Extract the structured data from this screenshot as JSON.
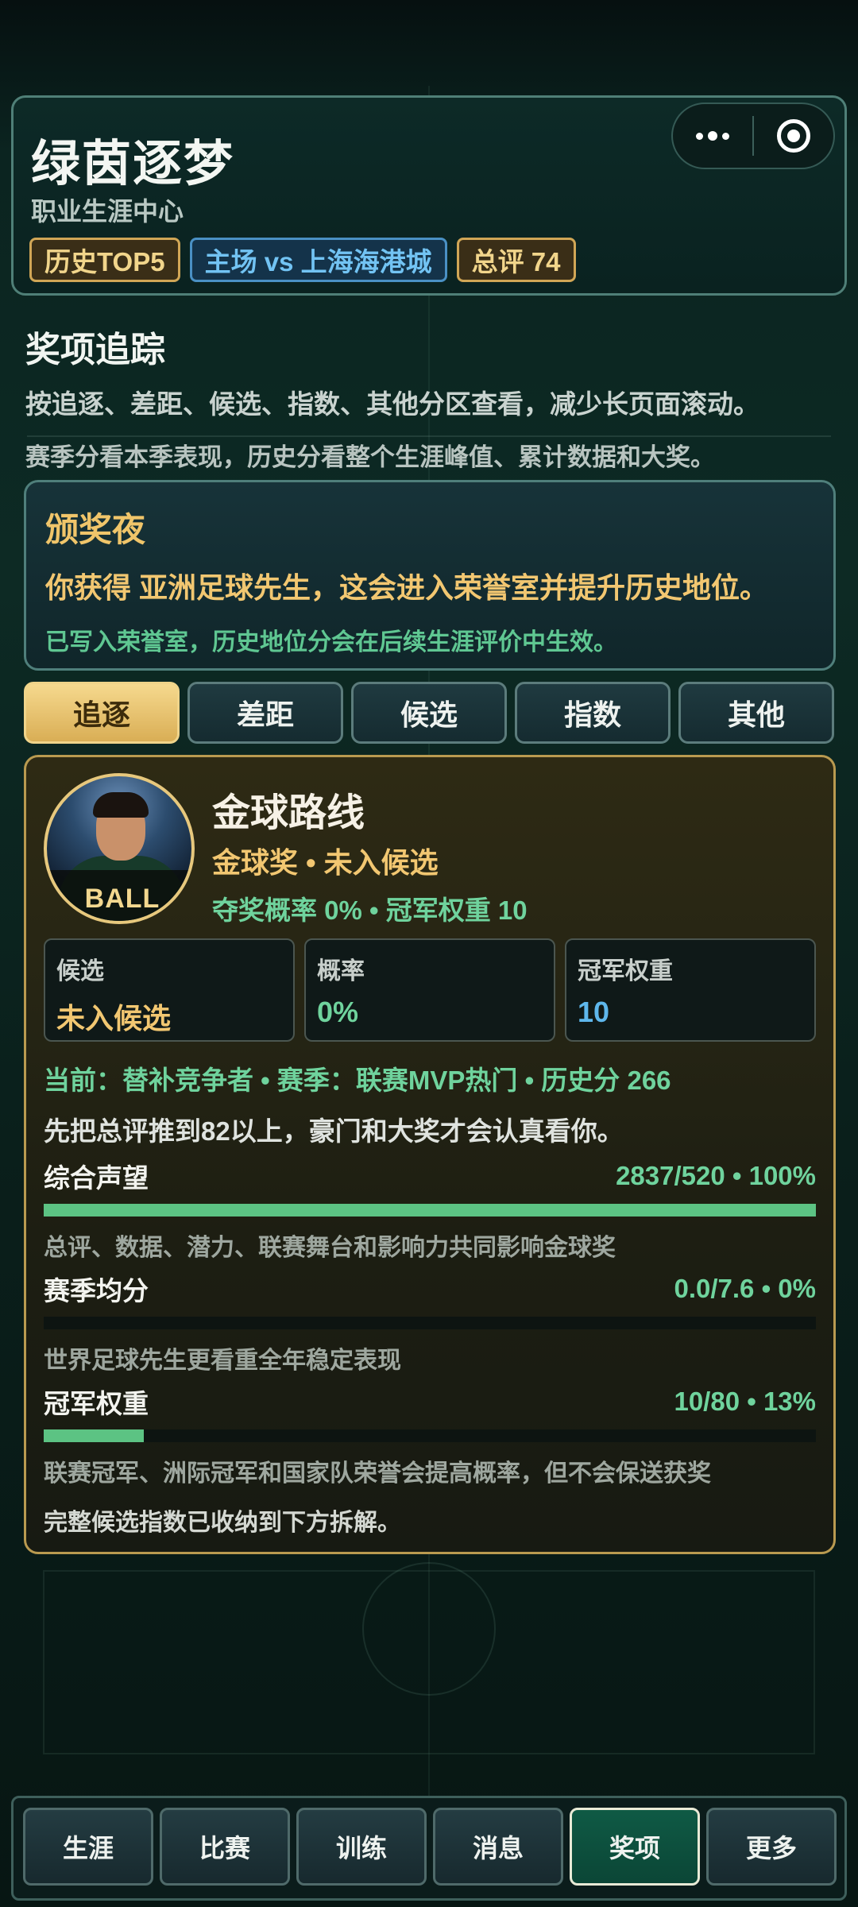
{
  "header": {
    "title": "绿茵逐梦",
    "subtitle": "职业生涯中心",
    "badges": [
      {
        "label": "历史TOP5",
        "style": "gold"
      },
      {
        "label": "主场 vs 上海海港城",
        "style": "blue"
      },
      {
        "label": "总评 74",
        "style": "gold"
      }
    ],
    "menu_icon": "more-dots-icon",
    "close_icon": "target-close-icon"
  },
  "section": {
    "title": "奖项追踪",
    "desc1": "按追逐、差距、候选、指数、其他分区查看，减少长页面滚动。",
    "desc2": "赛季分看本季表现，历史分看整个生涯峰值、累计数据和大奖。"
  },
  "award_night": {
    "title": "颁奖夜",
    "text": "你获得 亚洲足球先生，这会进入荣誉室并提升历史地位。",
    "note": "已写入荣誉室，历史地位分会在后续生涯评价中生效。"
  },
  "tabs": [
    {
      "label": "追逐",
      "active": true
    },
    {
      "label": "差距",
      "active": false
    },
    {
      "label": "候选",
      "active": false
    },
    {
      "label": "指数",
      "active": false
    },
    {
      "label": "其他",
      "active": false
    }
  ],
  "card": {
    "avatar_label": "BALL",
    "title": "金球路线",
    "subtitle": "金球奖 • 未入候选",
    "subtitle2": "夺奖概率 0% • 冠军权重 10",
    "stats": [
      {
        "label": "候选",
        "value": "未入候选",
        "color": "#f2c771"
      },
      {
        "label": "概率",
        "value": "0%",
        "color": "#6fd39d"
      },
      {
        "label": "冠军权重",
        "value": "10",
        "color": "#5eb7ec"
      }
    ],
    "info_line": "当前：替补竞争者 • 赛季：联赛MVP热门 • 历史分 266",
    "info_line2": "先把总评推到82以上，豪门和大奖才会认真看你。",
    "metrics": [
      {
        "name": "综合声望",
        "value": "2837/520 • 100%",
        "progress": 1.0,
        "note": "总评、数据、潜力、联赛舞台和影响力共同影响金球奖"
      },
      {
        "name": "赛季均分",
        "value": "0.0/7.6 • 0%",
        "progress": 0.0,
        "note": "世界足球先生更看重全年稳定表现"
      },
      {
        "name": "冠军权重",
        "value": "10/80 • 13%",
        "progress": 0.13,
        "note": "联赛冠军、洲际冠军和国家队荣誉会提高概率，但不会保送获奖"
      }
    ],
    "final_note": "完整候选指数已收纳到下方拆解。"
  },
  "bottom_nav": [
    {
      "label": "生涯",
      "active": false
    },
    {
      "label": "比赛",
      "active": false
    },
    {
      "label": "训练",
      "active": false
    },
    {
      "label": "消息",
      "active": false
    },
    {
      "label": "奖项",
      "active": true
    },
    {
      "label": "更多",
      "active": false
    }
  ]
}
